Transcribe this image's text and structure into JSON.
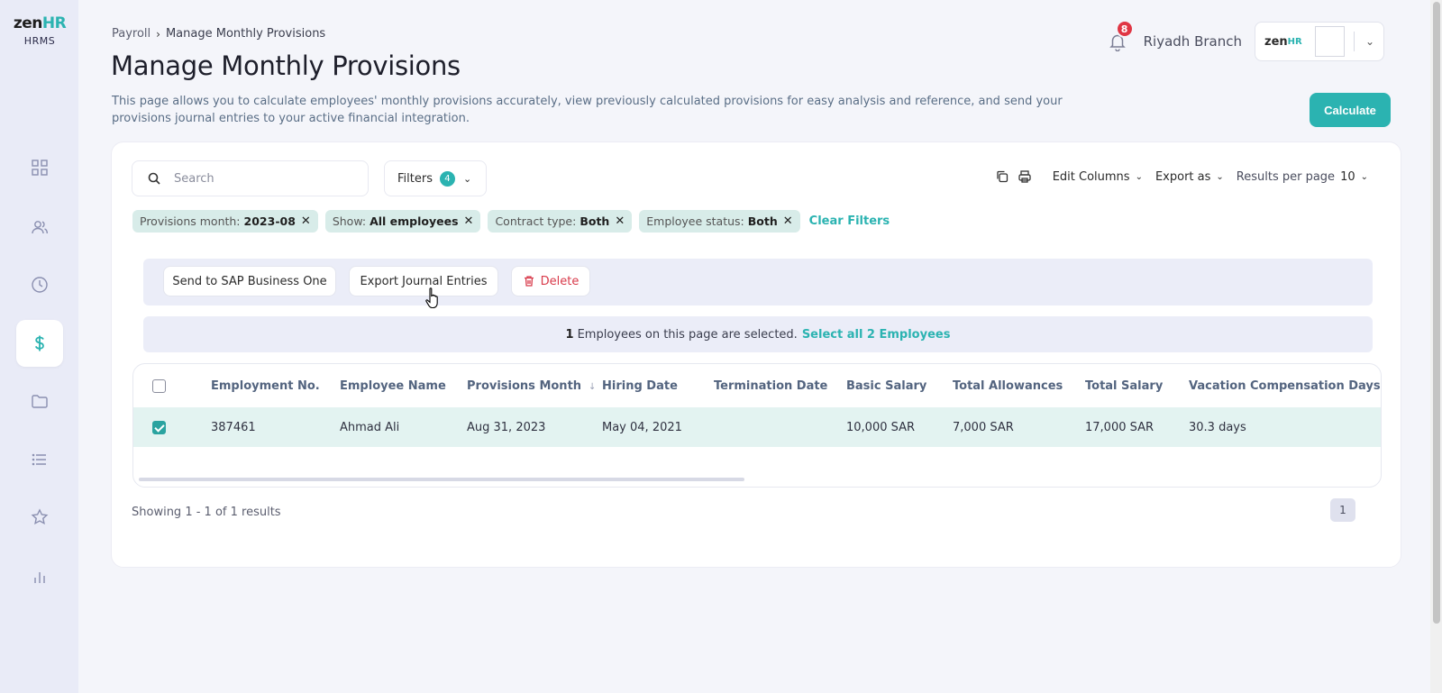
{
  "logo": {
    "main_prefix": "zen",
    "main_suffix": "HR",
    "sub": "HRMS"
  },
  "sidebar": {
    "items": [
      {
        "name": "dashboard",
        "icon": "grid-icon"
      },
      {
        "name": "employees",
        "icon": "users-icon"
      },
      {
        "name": "attendance",
        "icon": "clock-icon"
      },
      {
        "name": "payroll",
        "icon": "dollar-icon",
        "active": true
      },
      {
        "name": "documents",
        "icon": "folder-icon"
      },
      {
        "name": "requests",
        "icon": "list-icon"
      },
      {
        "name": "performance",
        "icon": "star-icon"
      },
      {
        "name": "reports",
        "icon": "bar-chart-icon"
      }
    ]
  },
  "breadcrumb": {
    "parent": "Payroll",
    "current": "Manage Monthly Provisions"
  },
  "page": {
    "title": "Manage Monthly Provisions",
    "description": "This page allows you to calculate employees' monthly provisions accurately, view previously calculated provisions for easy analysis and reference, and send your provisions journal entries to your active financial integration."
  },
  "header": {
    "notification_count": "8",
    "branch": "Riyadh Branch",
    "account_logo_prefix": "zen",
    "account_logo_suffix": "HR"
  },
  "calculate_label": "Calculate",
  "search": {
    "placeholder": "Search",
    "value": ""
  },
  "filters": {
    "label": "Filters",
    "count": "4"
  },
  "toolbar": {
    "edit_columns": "Edit Columns",
    "export_as": "Export as",
    "results_per_page_label": "Results per page",
    "results_per_page_value": "10"
  },
  "chips": [
    {
      "label": "Provisions month:",
      "value": "2023-08"
    },
    {
      "label": "Show:",
      "value": "All employees"
    },
    {
      "label": "Contract type:",
      "value": "Both"
    },
    {
      "label": "Employee status:",
      "value": "Both"
    }
  ],
  "clear_filters": "Clear Filters",
  "actions": {
    "send_sap": "Send to SAP Business One",
    "export_journal": "Export Journal Entries",
    "delete": "Delete"
  },
  "selection": {
    "count": "1",
    "text": "Employees on this page are selected.",
    "select_all": "Select all 2 Employees"
  },
  "table": {
    "columns": [
      "Employment No.",
      "Employee Name",
      "Provisions Month",
      "Hiring Date",
      "Termination Date",
      "Basic Salary",
      "Total Allowances",
      "Total Salary",
      "Vacation Compensation Days"
    ],
    "rows": [
      {
        "selected": true,
        "cells": [
          "387461",
          "Ahmad Ali",
          "Aug 31, 2023",
          "May 04, 2021",
          "",
          "10,000 SAR",
          "7,000 SAR",
          "17,000 SAR",
          "30.3 days"
        ]
      }
    ]
  },
  "pagination": {
    "showing": "Showing 1 - 1 of 1 results",
    "current_page": "1"
  },
  "colors": {
    "accent": "#2bb3b1",
    "danger": "#d83a4a",
    "sidebar_bg": "#e9ebf7",
    "page_bg": "#f4f5fa"
  }
}
